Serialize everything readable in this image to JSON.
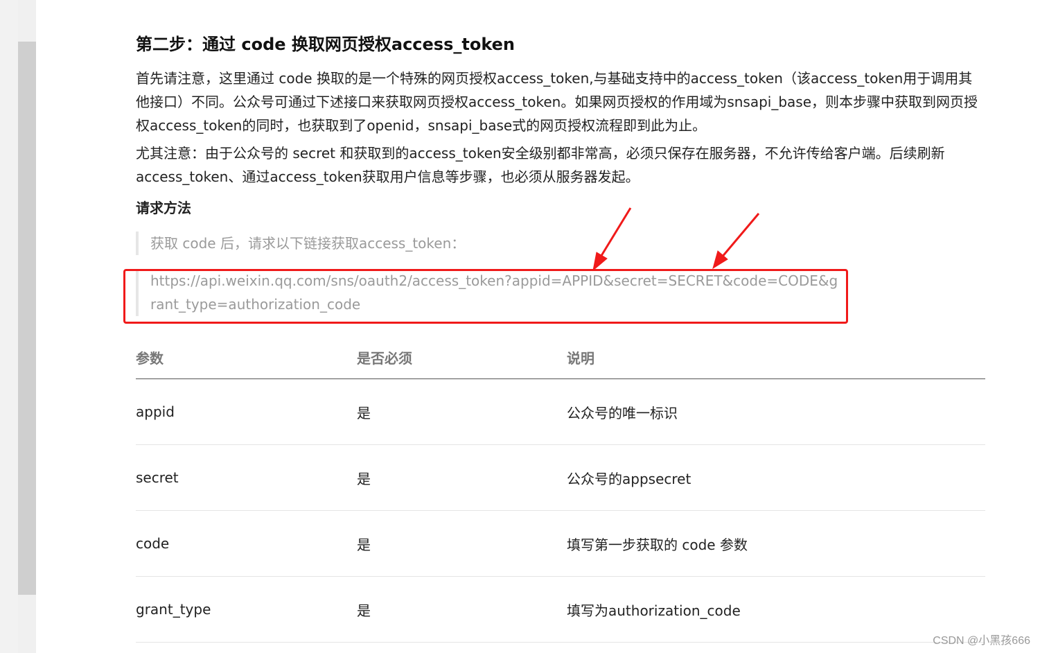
{
  "article": {
    "step_title": "第二步：通过 code 换取网页授权access_token",
    "para1": "首先请注意，这里通过 code 换取的是一个特殊的网页授权access_token,与基础支持中的access_token（该access_token用于调用其他接口）不同。公众号可通过下述接口来获取网页授权access_token。如果网页授权的作用域为snsapi_base，则本步骤中获取到网页授权access_token的同时，也获取到了openid，snsapi_base式的网页授权流程即到此为止。",
    "para2": "尤其注意：由于公众号的 secret 和获取到的access_token安全级别都非常高，必须只保存在服务器，不允许传给客户端。后续刷新access_token、通过access_token获取用户信息等步骤，也必须从服务器发起。",
    "request_heading": "请求方法",
    "quote_intro": "获取 code 后，请求以下链接获取access_token：",
    "request_url": "https://api.weixin.qq.com/sns/oauth2/access_token?appid=APPID&secret=SECRET&code=CODE&grant_type=authorization_code"
  },
  "table": {
    "headers": [
      "参数",
      "是否必须",
      "说明"
    ],
    "rows": [
      [
        "appid",
        "是",
        "公众号的唯一标识"
      ],
      [
        "secret",
        "是",
        "公众号的appsecret"
      ],
      [
        "code",
        "是",
        "填写第一步获取的 code 参数"
      ],
      [
        "grant_type",
        "是",
        "填写为authorization_code"
      ]
    ]
  },
  "watermark": "CSDN @小黑孩666",
  "colors": {
    "highlight": "#f01a1a",
    "quote_text": "#9a9a9a"
  }
}
